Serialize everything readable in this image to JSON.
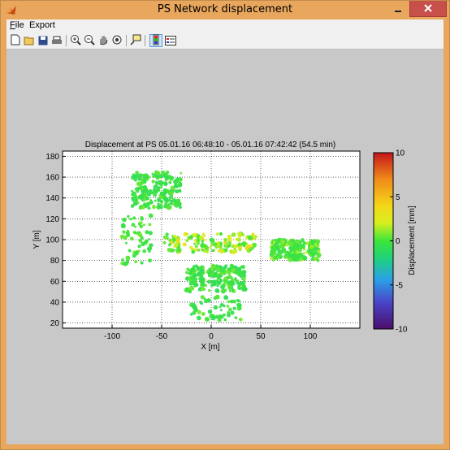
{
  "window": {
    "title": "PS Network displacement",
    "title_icon": "matlab-icon",
    "controls": [
      "minimize-icon",
      "close-icon"
    ],
    "colors": {
      "titlebar": "#e9a75d",
      "close": "#c7504a",
      "client": "#c8c8c8"
    }
  },
  "menu": {
    "items": [
      {
        "label": "File",
        "hotkey": "F"
      },
      {
        "label": "Export"
      }
    ]
  },
  "toolbar": {
    "buttons": [
      {
        "name": "new-file-icon",
        "tooltip": ""
      },
      {
        "name": "open-folder-icon",
        "tooltip": ""
      },
      {
        "name": "save-icon",
        "tooltip": ""
      },
      {
        "name": "print-icon",
        "tooltip": ""
      },
      {
        "name": "zoom-in-icon",
        "tooltip": ""
      },
      {
        "name": "zoom-out-icon",
        "tooltip": ""
      },
      {
        "name": "pan-hand-icon",
        "tooltip": ""
      },
      {
        "name": "rotate-3d-icon",
        "tooltip": ""
      },
      {
        "name": "data-cursor-icon",
        "tooltip": ""
      },
      {
        "name": "colorbar-toggle-icon",
        "tooltip": "",
        "pressed": true
      },
      {
        "name": "legend-toggle-icon",
        "tooltip": ""
      }
    ]
  },
  "chart_data": {
    "type": "scatter",
    "title": "Displacement at PS 05.01.16 06:48:10 - 05.01.16 07:42:42 (54.5 min)",
    "xlabel": "X [m]",
    "ylabel": "Y [m]",
    "xlim": [
      -150,
      150
    ],
    "ylim": [
      15,
      185
    ],
    "xticks": [
      -100,
      -50,
      0,
      50,
      100
    ],
    "yticks": [
      20,
      40,
      60,
      80,
      100,
      120,
      140,
      160,
      180
    ],
    "grid": true,
    "colorbar": {
      "label": "Displacement [mm]",
      "range": [
        -10,
        10
      ],
      "ticks": [
        10,
        5,
        0,
        -5,
        -10
      ],
      "colormap": [
        "#4b0d6b",
        "#4a44c8",
        "#2aa0e8",
        "#1fd17b",
        "#3ee53a",
        "#d6ef1e",
        "#f5d619",
        "#f08a19",
        "#c4161c"
      ]
    },
    "clusters": [
      {
        "region": "upper-left",
        "x_range": [
          -80,
          -30
        ],
        "y_range": [
          130,
          165
        ],
        "displacement_mm": [
          -1,
          1
        ]
      },
      {
        "region": "left-sparse",
        "x_range": [
          -90,
          -60
        ],
        "y_range": [
          75,
          125
        ],
        "displacement_mm": [
          -0.5,
          1
        ]
      },
      {
        "region": "center-band",
        "x_range": [
          -50,
          45
        ],
        "y_range": [
          88,
          106
        ],
        "displacement_mm": [
          0,
          4.5
        ]
      },
      {
        "region": "lower-center",
        "x_range": [
          -25,
          35
        ],
        "y_range": [
          50,
          75
        ],
        "displacement_mm": [
          -1,
          1
        ]
      },
      {
        "region": "right",
        "x_range": [
          60,
          110
        ],
        "y_range": [
          80,
          100
        ],
        "displacement_mm": [
          -0.5,
          2
        ]
      },
      {
        "region": "bottom-sparse",
        "x_range": [
          -20,
          30
        ],
        "y_range": [
          22,
          45
        ],
        "displacement_mm": [
          -1,
          1
        ]
      }
    ]
  }
}
